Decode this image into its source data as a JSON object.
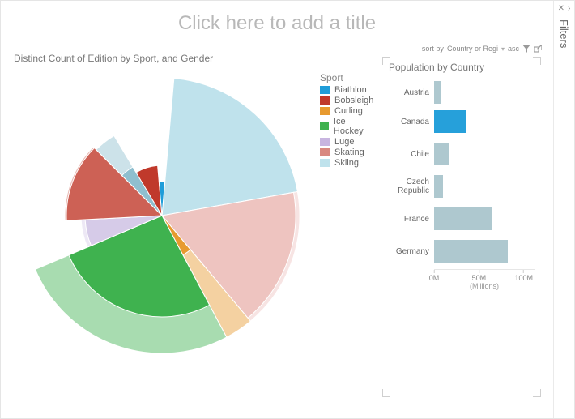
{
  "filters_rail": {
    "label": "Filters",
    "close_glyph": "✕",
    "expand_glyph": "›"
  },
  "title_placeholder": "Click here to add a title",
  "pie": {
    "title": "Distinct Count of Edition by Sport, and Gender",
    "legend_title": "Sport",
    "legend": [
      {
        "label": "Biathlon",
        "color": "#1f9dd9"
      },
      {
        "label": "Bobsleigh",
        "color": "#c0392b"
      },
      {
        "label": "Curling",
        "color": "#e79a2f"
      },
      {
        "label": "Ice Hockey",
        "color": "#3fb24f"
      },
      {
        "label": "Luge",
        "color": "#c8b5e0"
      },
      {
        "label": "Skating",
        "color": "#d98880"
      },
      {
        "label": "Skiing",
        "color": "#bfe2ec"
      }
    ]
  },
  "bar": {
    "toolbar": {
      "sort_by_label": "sort by",
      "sort_by_value": "Country or Regi",
      "order": "asc"
    },
    "title": "Population by Country",
    "xlabel": "(Millions)",
    "ticks": [
      {
        "label": "0M",
        "pos": 0
      },
      {
        "label": "50M",
        "pos": 50
      },
      {
        "label": "100M",
        "pos": 100
      }
    ],
    "max": 112
  },
  "chart_data": [
    {
      "type": "pie",
      "title": "Distinct Count of Edition by Sport, and Gender",
      "note": "Nightingale/rose pie — slice angle encodes category share, slice radius encodes value magnitude. Two rings per category represent Gender (inner=one gender, outer=other).",
      "outer_radius_scale_max": 170,
      "slices": [
        {
          "sport": "Skiing",
          "color": "#bfe2ec",
          "angle_deg": 75,
          "radius_inner": 170,
          "radius_outer": 170
        },
        {
          "sport": "Skating",
          "color": "#eec4c0",
          "angle_deg": 60,
          "radius_inner": 165,
          "radius_outer": 170
        },
        {
          "sport": "Curling",
          "color": "#e79a2f",
          "angle_deg": 12,
          "radius_inner": 55,
          "radius_outer": 170
        },
        {
          "sport": "Ice Hockey",
          "color": "#3fb24f",
          "angle_deg": 95,
          "radius_inner": 125,
          "radius_outer": 170
        },
        {
          "sport": "Luge",
          "color": "#d6cbe8",
          "angle_deg": 20,
          "radius_inner": 95,
          "radius_outer": 100
        },
        {
          "sport": "Skating",
          "color": "#cd6155",
          "angle_deg": 48,
          "radius_inner": 118,
          "radius_outer": 120
        },
        {
          "sport": "Skiing",
          "color": "#8fbfcf",
          "angle_deg": 14,
          "radius_inner": 70,
          "radius_outer": 115
        },
        {
          "sport": "Bobsleigh",
          "color": "#c0392b",
          "angle_deg": 26,
          "radius_inner": 62,
          "radius_outer": 62
        },
        {
          "sport": "Biathlon",
          "color": "#1f9dd9",
          "angle_deg": 10,
          "radius_inner": 42,
          "radius_outer": 42
        }
      ]
    },
    {
      "type": "bar",
      "orientation": "horizontal",
      "title": "Population by Country",
      "xlabel": "(Millions)",
      "xlim": [
        0,
        112
      ],
      "categories": [
        "Austria",
        "Canada",
        "Chile",
        "Czech Republic",
        "France",
        "Germany"
      ],
      "values": [
        8,
        35,
        17,
        10,
        65,
        82
      ],
      "highlighted_index": 1
    }
  ]
}
